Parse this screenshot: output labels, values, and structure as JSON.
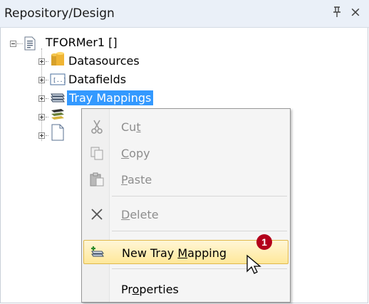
{
  "panel": {
    "title": "Repository/Design",
    "pin_glyph": "ᵖ",
    "close_glyph": "×"
  },
  "tree": {
    "root": "TFORMer1 []",
    "items": [
      {
        "label": "Datasources",
        "icon": "database-icon"
      },
      {
        "label": "Datafields",
        "icon": "field-icon"
      },
      {
        "label": "Tray Mappings",
        "icon": "tray-mapping-icon",
        "selected": true
      },
      {
        "label": "",
        "icon": "layers-icon"
      },
      {
        "label": "",
        "icon": "page-icon"
      }
    ]
  },
  "context_menu": {
    "items": [
      {
        "label": "Cut",
        "mnemonic": "t",
        "enabled": false,
        "icon": "scissors-icon"
      },
      {
        "label": "Copy",
        "mnemonic": "C",
        "enabled": false,
        "icon": "copy-icon"
      },
      {
        "label": "Paste",
        "mnemonic": "P",
        "enabled": false,
        "icon": "paste-icon"
      },
      {
        "label": "Delete",
        "mnemonic": "D",
        "enabled": false,
        "icon": "delete-x-icon"
      },
      {
        "label": "New Tray Mapping",
        "mnemonic": "M",
        "enabled": true,
        "highlighted": true,
        "icon": "new-tray-mapping-icon"
      },
      {
        "label": "Properties",
        "mnemonic": "o",
        "enabled": true,
        "icon": ""
      }
    ]
  },
  "callout": "1",
  "colors": {
    "selection": "#3399ff",
    "highlight": "#ffe89a",
    "badge": "#b3001b"
  }
}
